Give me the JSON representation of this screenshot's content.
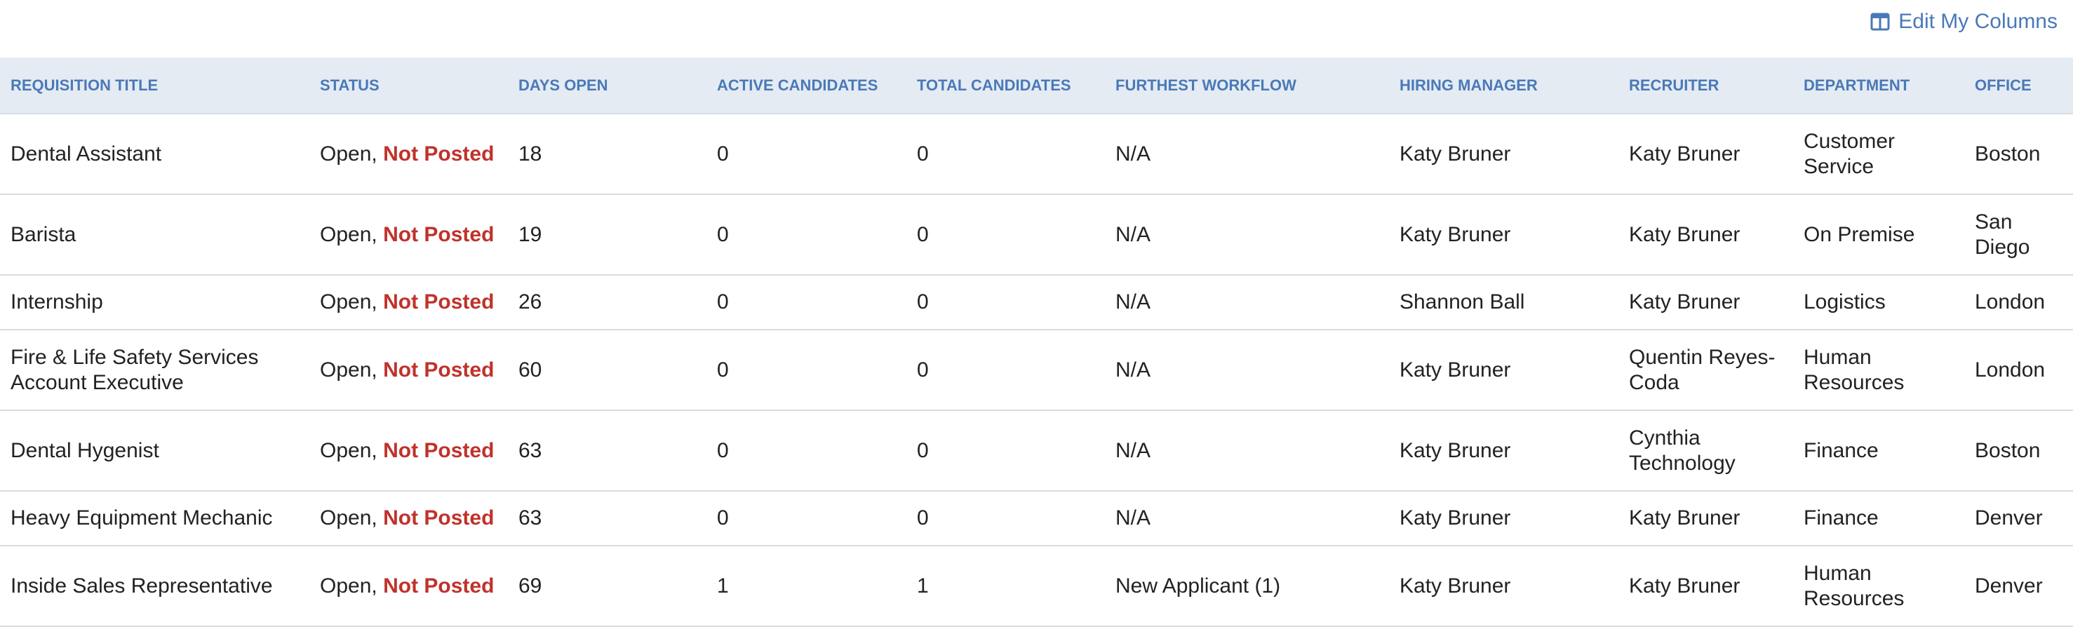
{
  "toolbar": {
    "edit_columns_label": "Edit My Columns",
    "edit_columns_icon": "columns-icon"
  },
  "colors": {
    "accent": "#4a79b8",
    "header_bg": "#e4ebf3",
    "not_posted": "#c0322b"
  },
  "table": {
    "headers": [
      "REQUISITION TITLE",
      "STATUS",
      "DAYS OPEN",
      "ACTIVE CANDIDATES",
      "TOTAL CANDIDATES",
      "FURTHEST WORKFLOW",
      "HIRING MANAGER",
      "RECRUITER",
      "DEPARTMENT",
      "OFFICE"
    ],
    "rows": [
      {
        "title": "Dental Assistant",
        "status_prefix": "Open,",
        "status_flag": "Not Posted",
        "days_open": "18",
        "active": "0",
        "total": "0",
        "workflow": "N/A",
        "hiring_manager": "Katy Bruner",
        "recruiter": "Katy Bruner",
        "department": "Customer Service",
        "office": "Boston"
      },
      {
        "title": "Barista",
        "status_prefix": "Open,",
        "status_flag": "Not Posted",
        "days_open": "19",
        "active": "0",
        "total": "0",
        "workflow": "N/A",
        "hiring_manager": "Katy Bruner",
        "recruiter": "Katy Bruner",
        "department": "On Premise",
        "office": "San Diego"
      },
      {
        "title": "Internship",
        "status_prefix": "Open,",
        "status_flag": "Not Posted",
        "days_open": "26",
        "active": "0",
        "total": "0",
        "workflow": "N/A",
        "hiring_manager": "Shannon Ball",
        "recruiter": "Katy Bruner",
        "department": "Logistics",
        "office": "London"
      },
      {
        "title": "Fire & Life Safety Services Account Executive",
        "status_prefix": "Open,",
        "status_flag": "Not Posted",
        "days_open": "60",
        "active": "0",
        "total": "0",
        "workflow": "N/A",
        "hiring_manager": "Katy Bruner",
        "recruiter": "Quentin Reyes-Coda",
        "department": "Human Resources",
        "office": "London"
      },
      {
        "title": "Dental Hygenist",
        "status_prefix": "Open,",
        "status_flag": "Not Posted",
        "days_open": "63",
        "active": "0",
        "total": "0",
        "workflow": "N/A",
        "hiring_manager": "Katy Bruner",
        "recruiter": "Cynthia Technology",
        "department": "Finance",
        "office": "Boston"
      },
      {
        "title": "Heavy Equipment Mechanic",
        "status_prefix": "Open,",
        "status_flag": "Not Posted",
        "days_open": "63",
        "active": "0",
        "total": "0",
        "workflow": "N/A",
        "hiring_manager": "Katy Bruner",
        "recruiter": "Katy Bruner",
        "department": "Finance",
        "office": "Denver"
      },
      {
        "title": "Inside Sales Representative",
        "status_prefix": "Open,",
        "status_flag": "Not Posted",
        "days_open": "69",
        "active": "1",
        "total": "1",
        "workflow": "New Applicant (1)",
        "hiring_manager": "Katy Bruner",
        "recruiter": "Katy Bruner",
        "department": "Human Resources",
        "office": "Denver"
      }
    ]
  }
}
